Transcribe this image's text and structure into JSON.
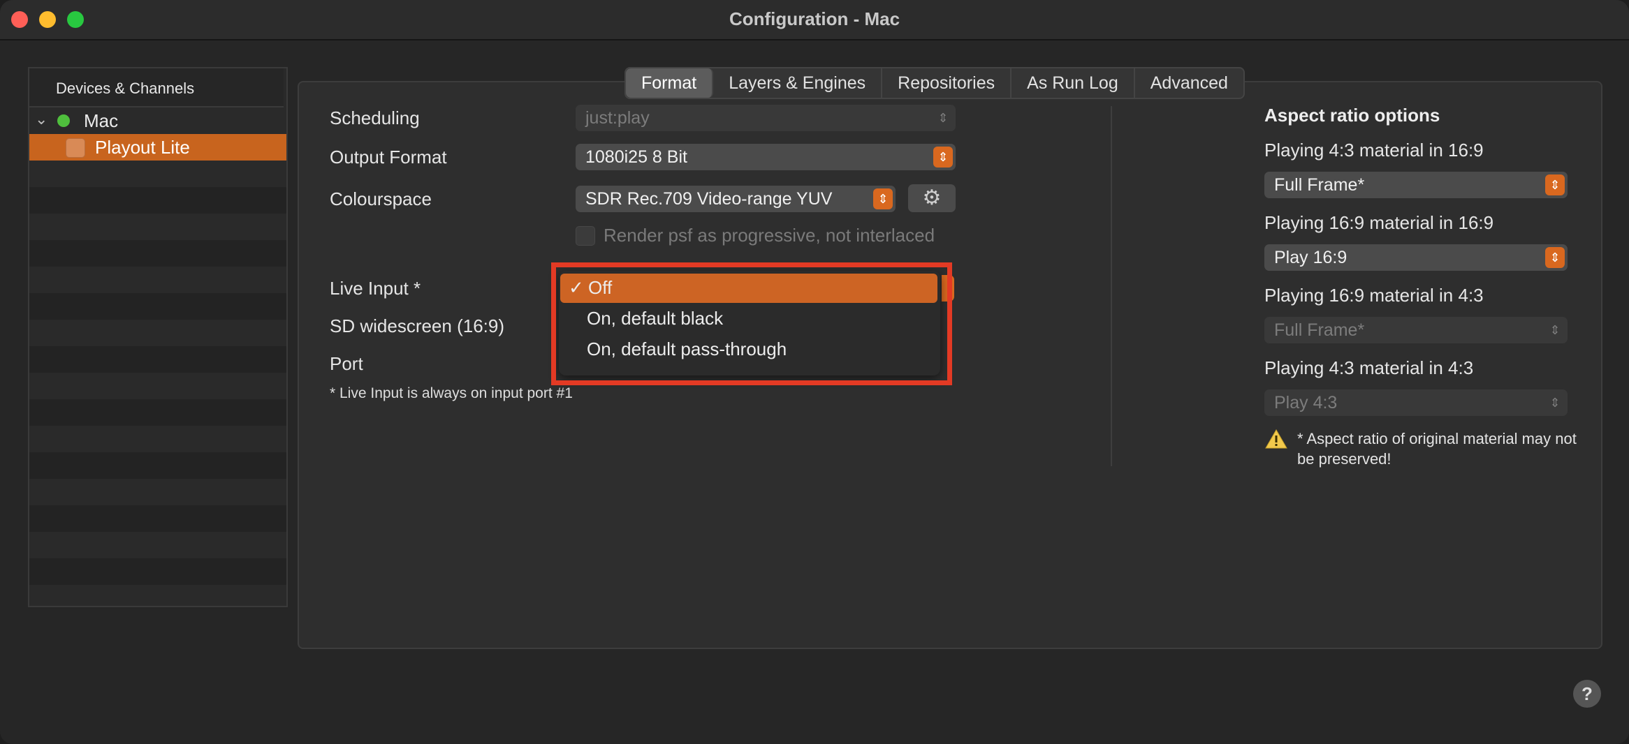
{
  "window": {
    "title": "Configuration - Mac"
  },
  "sidebar": {
    "header": "Devices & Channels",
    "device": {
      "label": "Mac",
      "status_color": "#4fbf3d"
    },
    "channel": {
      "label": "Playout Lite"
    }
  },
  "tabs": [
    {
      "label": "Format",
      "active": true
    },
    {
      "label": "Layers & Engines"
    },
    {
      "label": "Repositories"
    },
    {
      "label": "As Run Log"
    },
    {
      "label": "Advanced"
    }
  ],
  "format": {
    "scheduling_label": "Scheduling",
    "scheduling_value": "just:play",
    "output_format_label": "Output Format",
    "output_format_value": "1080i25 8 Bit",
    "colourspace_label": "Colourspace",
    "colourspace_value": "SDR Rec.709 Video-range YUV",
    "render_psf_label": "Render psf as progressive, not interlaced",
    "live_input_label": "Live Input *",
    "sd_widescreen_label": "SD widescreen (16:9)",
    "port_label": "Port",
    "note": "* Live Input is always on input port #1"
  },
  "live_input_menu": {
    "check_glyph": "✓",
    "options": [
      "Off",
      "On, default black",
      "On, default pass-through"
    ],
    "selected": "Off"
  },
  "aspect": {
    "title": "Aspect ratio options",
    "rows": [
      {
        "label": "Playing 4:3 material in 16:9",
        "value": "Full Frame*",
        "enabled": true
      },
      {
        "label": "Playing 16:9 material in 16:9",
        "value": "Play 16:9",
        "enabled": true
      },
      {
        "label": "Playing 16:9 material in 4:3",
        "value": "Full Frame*",
        "enabled": false
      },
      {
        "label": "Playing 4:3 material in 4:3",
        "value": "Play 4:3",
        "enabled": false
      }
    ],
    "warning": "* Aspect ratio of original material may not be preserved!"
  },
  "help_label": "?",
  "colors": {
    "accent": "#d9681f",
    "highlight_border": "#e33a24"
  }
}
